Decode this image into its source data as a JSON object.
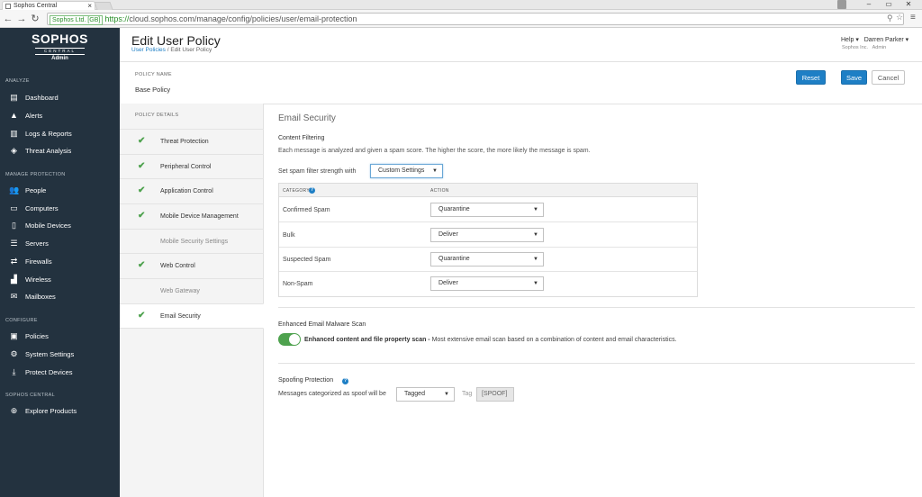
{
  "browser": {
    "tab_title": "Sophos Central",
    "tab_close": "×",
    "window_controls": [
      "–",
      "▭",
      "✕"
    ],
    "security_badge": "Sophos Ltd. [GB]",
    "url_scheme": "https://",
    "url_rest": "cloud.sophos.com/manage/config/policies/user/email-protection"
  },
  "sidebar": {
    "brand": "SOPHOS",
    "brand_sub": "CENTRAL",
    "role": "Admin",
    "sections": [
      {
        "heading": "ANALYZE",
        "items": [
          {
            "label": "Dashboard",
            "icon": "dashboard-icon"
          },
          {
            "label": "Alerts",
            "icon": "alert-icon"
          },
          {
            "label": "Logs & Reports",
            "icon": "reports-icon"
          },
          {
            "label": "Threat Analysis",
            "icon": "threat-analysis-icon"
          }
        ]
      },
      {
        "heading": "MANAGE PROTECTION",
        "items": [
          {
            "label": "People",
            "icon": "people-icon"
          },
          {
            "label": "Computers",
            "icon": "computer-icon"
          },
          {
            "label": "Mobile Devices",
            "icon": "mobile-icon"
          },
          {
            "label": "Servers",
            "icon": "server-icon"
          },
          {
            "label": "Firewalls",
            "icon": "firewall-icon"
          },
          {
            "label": "Wireless",
            "icon": "wireless-icon"
          },
          {
            "label": "Mailboxes",
            "icon": "mailbox-icon"
          }
        ]
      },
      {
        "heading": "CONFIGURE",
        "items": [
          {
            "label": "Policies",
            "icon": "policies-icon"
          },
          {
            "label": "System Settings",
            "icon": "settings-icon"
          },
          {
            "label": "Protect Devices",
            "icon": "download-icon"
          }
        ]
      },
      {
        "heading": "SOPHOS CENTRAL",
        "items": [
          {
            "label": "Explore Products",
            "icon": "explore-icon"
          }
        ]
      }
    ]
  },
  "header": {
    "title": "Edit User Policy",
    "breadcrumb_link": "User Policies",
    "breadcrumb_sep": " / ",
    "breadcrumb_current": "Edit User Policy",
    "help": "Help ▾",
    "user_name": "Darren Parker ▾",
    "org": "Sophos Inc.",
    "user_role": "Admin"
  },
  "policy": {
    "name_label": "POLICY NAME",
    "name_value": "Base Policy",
    "reset_label": "Reset",
    "save_label": "Save",
    "cancel_label": "Cancel"
  },
  "details": {
    "label": "POLICY DETAILS",
    "items": [
      {
        "label": "Threat Protection",
        "checked": true
      },
      {
        "label": "Peripheral Control",
        "checked": true
      },
      {
        "label": "Application Control",
        "checked": true
      },
      {
        "label": "Mobile Device Management",
        "checked": true
      },
      {
        "label": "Mobile Security Settings",
        "checked": false
      },
      {
        "label": "Web Control",
        "checked": true
      },
      {
        "label": "Web Gateway",
        "checked": false
      },
      {
        "label": "Email Security",
        "checked": true
      }
    ]
  },
  "email_security": {
    "title": "Email Security",
    "content_filtering": {
      "title": "Content Filtering",
      "description": "Each message is analyzed and given a spam score. The higher the score, the more likely the message is spam.",
      "strength_label": "Set spam filter strength with",
      "strength_value": "Custom Settings",
      "col_category": "CATEGORY",
      "col_action": "ACTION",
      "rows": [
        {
          "category": "Confirmed Spam",
          "action": "Quarantine"
        },
        {
          "category": "Bulk",
          "action": "Deliver"
        },
        {
          "category": "Suspected Spam",
          "action": "Quarantine"
        },
        {
          "category": "Non-Spam",
          "action": "Deliver"
        }
      ]
    },
    "malware_scan": {
      "title": "Enhanced Email Malware Scan",
      "toggle_on": true,
      "label_bold": "Enhanced content and file property scan -",
      "label_rest": " Most extensive email scan based on a combination of content and email characteristics."
    },
    "spoofing": {
      "title": "Spoofing Protection",
      "label": "Messages categorized as spoof will be",
      "action": "Tagged",
      "tag_label": "Tag",
      "tag_value": "[SPOOF]"
    }
  },
  "colors": {
    "sidebar_bg": "#23323f",
    "primary_button": "#1e7fc5",
    "check_green": "#4ea24e"
  }
}
